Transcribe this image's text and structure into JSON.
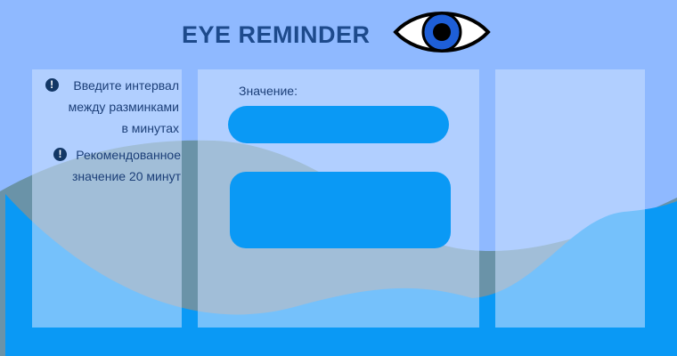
{
  "app": {
    "title": "EYE REMINDER",
    "logo_icon": "eye-icon"
  },
  "hints": [
    {
      "icon": "info-icon",
      "lines": [
        "Введите интервал",
        "между разминками",
        "в минутах"
      ]
    },
    {
      "icon": "info-icon",
      "lines": [
        "Рекомендованное",
        "значение 20 минут"
      ]
    }
  ],
  "form": {
    "value_label": "Значение:",
    "value_input": "",
    "submit_label": ""
  },
  "colors": {
    "background": "#8fb9ff",
    "accent": "#0a99f5",
    "title": "#1d4a8c",
    "wave_front": "#0a99f5",
    "wave_back": "#6a93a8"
  }
}
